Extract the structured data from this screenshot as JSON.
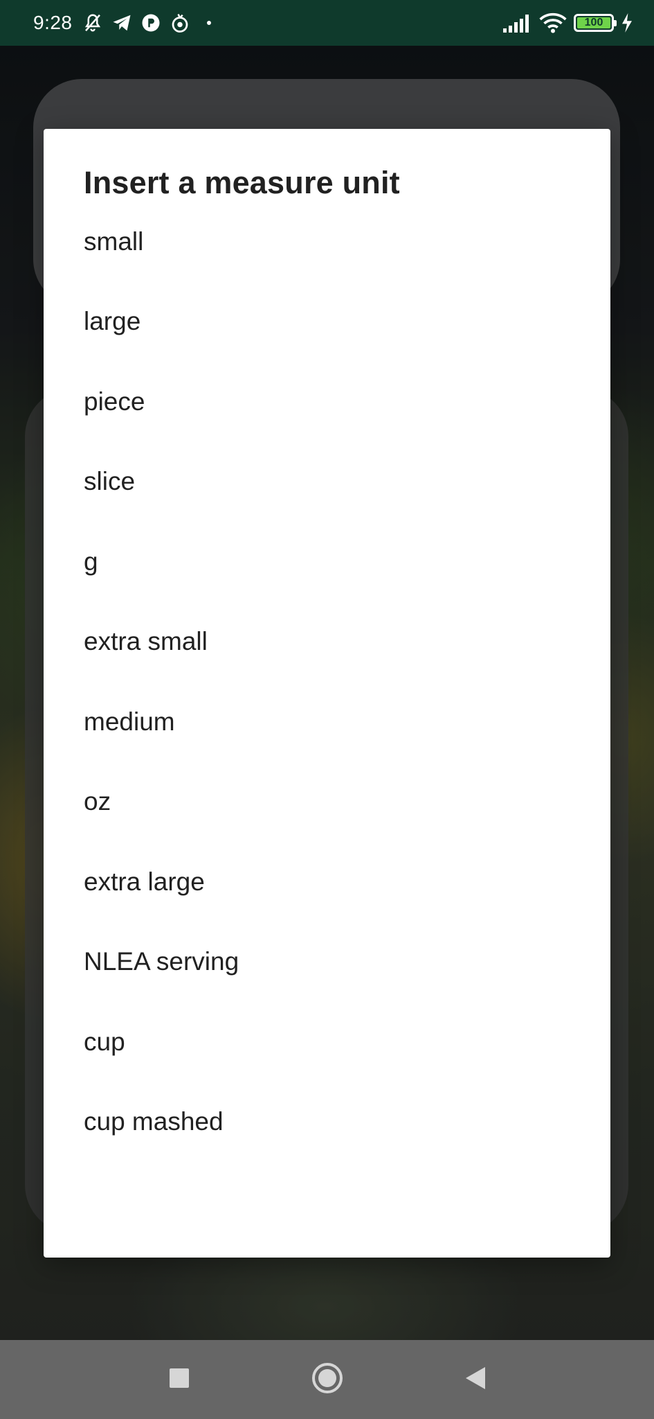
{
  "status_bar": {
    "time": "9:28",
    "battery_level": "100",
    "accent_color": "#0f3a2c",
    "battery_color": "#6fd34a",
    "icons_left": [
      "bell-off-icon",
      "telegram-icon",
      "app-icon",
      "tomato-icon"
    ],
    "icons_right": [
      "signal-icon",
      "wifi-icon",
      "battery-icon",
      "charging-icon"
    ]
  },
  "dialog": {
    "title": "Insert a measure unit",
    "items": [
      {
        "label": "small"
      },
      {
        "label": "large"
      },
      {
        "label": "piece"
      },
      {
        "label": "slice"
      },
      {
        "label": "g"
      },
      {
        "label": "extra small"
      },
      {
        "label": "medium"
      },
      {
        "label": "oz"
      },
      {
        "label": "extra large"
      },
      {
        "label": "NLEA serving"
      },
      {
        "label": "cup"
      },
      {
        "label": "cup mashed"
      }
    ]
  },
  "nav_bar": {
    "buttons": [
      "recents-icon",
      "home-icon",
      "back-icon"
    ]
  }
}
